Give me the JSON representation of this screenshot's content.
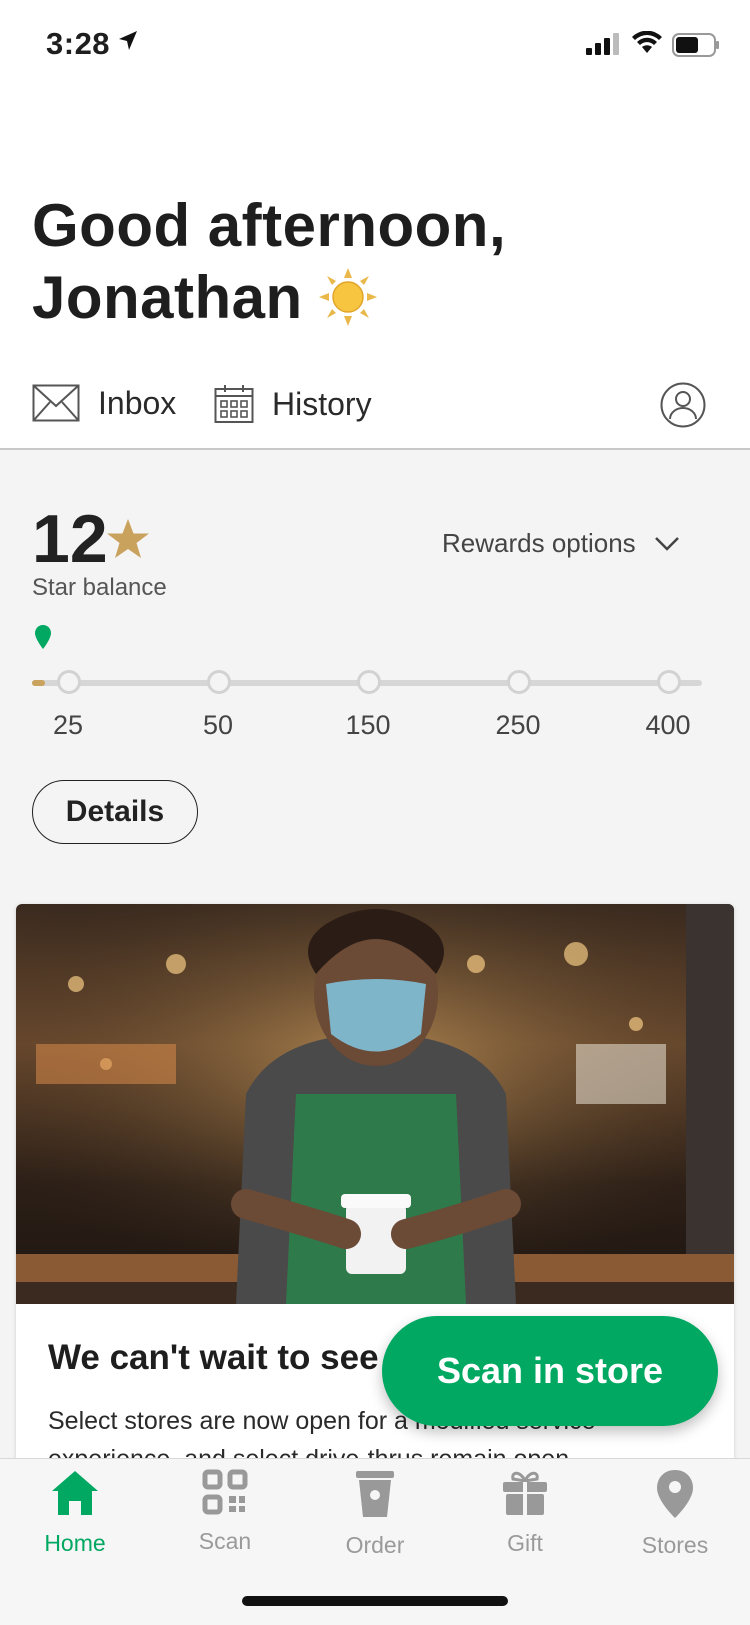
{
  "status_bar": {
    "time": "3:28"
  },
  "greeting": {
    "line1": "Good afternoon,",
    "line2": "Jonathan"
  },
  "nav": {
    "inbox": "Inbox",
    "history": "History"
  },
  "rewards": {
    "star_count": "12",
    "star_label": "Star balance",
    "options_label": "Rewards options",
    "milestones": [
      "25",
      "50",
      "150",
      "250",
      "400"
    ],
    "progress_fraction": 0.02,
    "details_label": "Details"
  },
  "card": {
    "title": "We can't wait to see you",
    "body": "Select stores are now open for a modified service experience, and select drive-thrus remain open."
  },
  "scan_button": "Scan in store",
  "tabs": [
    {
      "label": "Home",
      "icon": "home-icon",
      "active": true
    },
    {
      "label": "Scan",
      "icon": "qr-code-icon",
      "active": false
    },
    {
      "label": "Order",
      "icon": "cup-icon",
      "active": false
    },
    {
      "label": "Gift",
      "icon": "gift-icon",
      "active": false
    },
    {
      "label": "Stores",
      "icon": "location-pin-icon",
      "active": false
    }
  ],
  "colors": {
    "brand_green": "#00a862",
    "star_gold": "#c9a25e"
  }
}
